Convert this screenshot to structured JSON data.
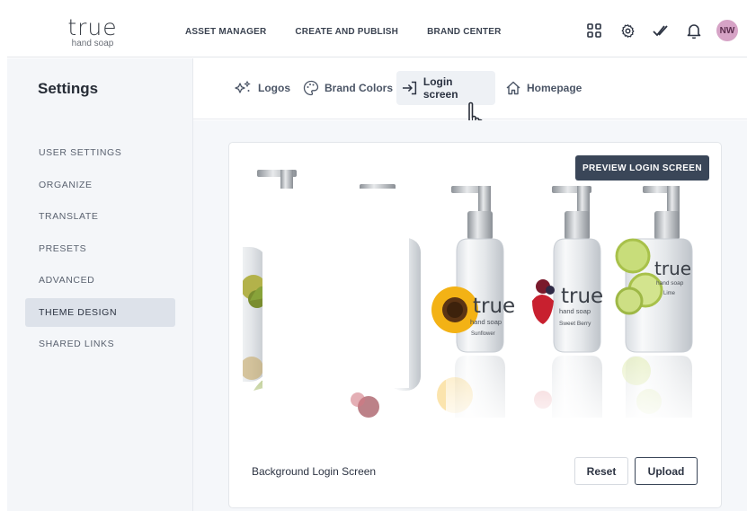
{
  "brand": {
    "logo_main": "true",
    "logo_sub": "hand soap"
  },
  "topnav": [
    "ASSET MANAGER",
    "CREATE AND PUBLISH",
    "BRAND CENTER"
  ],
  "top_icons": [
    "grid-icon",
    "gear-icon",
    "checks-icon",
    "bell-icon"
  ],
  "user": {
    "initials": "NW",
    "color": "#d6a3c6"
  },
  "sidebar": {
    "title": "Settings",
    "items": [
      {
        "label": "USER SETTINGS"
      },
      {
        "label": "ORGANIZE"
      },
      {
        "label": "TRANSLATE"
      },
      {
        "label": "PRESETS"
      },
      {
        "label": "ADVANCED"
      },
      {
        "label": "THEME DESIGN",
        "active": true
      },
      {
        "label": "SHARED LINKS"
      }
    ]
  },
  "subtabs": [
    {
      "label": "Logos",
      "icon": "sparkle-icon"
    },
    {
      "label": "Brand Colors",
      "icon": "palette-icon"
    },
    {
      "label": "Login screen",
      "icon": "login-icon",
      "active": true
    },
    {
      "label": "Homepage",
      "icon": "home-icon"
    }
  ],
  "card": {
    "preview_button": "PREVIEW LOGIN SCREEN",
    "bg_label": "Background Login Screen",
    "reset_label": "Reset",
    "upload_label": "Upload"
  },
  "bottles": [
    {
      "brand": "true",
      "sub": "hand soap",
      "scent": "Sunflower",
      "fine": "All natural ingredients for truly clean hands",
      "size": "7.5 fl oz (221 ml)"
    },
    {
      "brand": "true",
      "sub": "hand soap",
      "scent": "Sweet Berry",
      "fine": "All natural ingredients for truly clean hands",
      "size": "7.5 fl oz (221 ml)"
    },
    {
      "brand": "true",
      "sub": "hand soap",
      "scent": "Lime",
      "fine": "All natural ingredients for truly clean hands",
      "size": "7.5 fl oz (221 ml)"
    }
  ],
  "colors": {
    "accent_dark": "#3a4658",
    "sidebar_bg": "#f4f6f9",
    "active_item": "#dde2ea"
  }
}
